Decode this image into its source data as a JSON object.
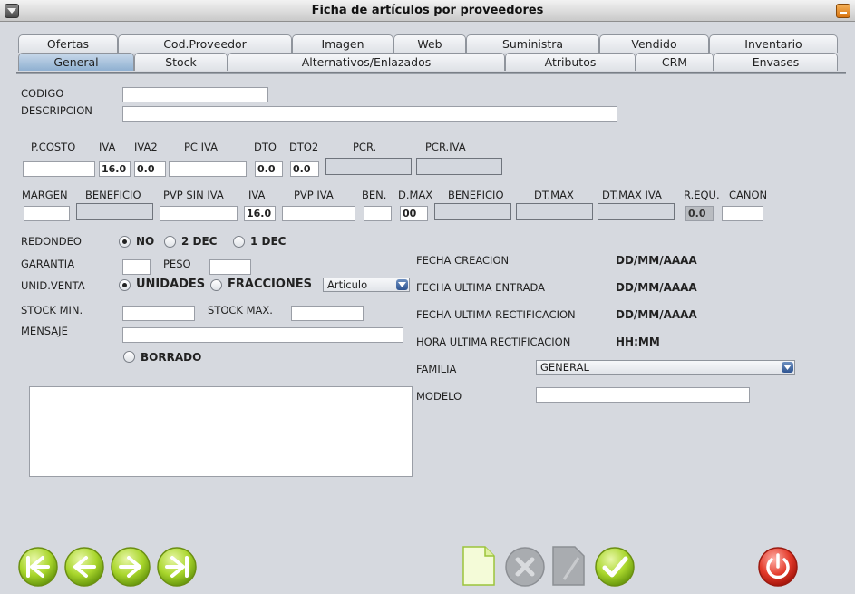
{
  "window": {
    "title": "Ficha de artículos por proveedores"
  },
  "tabs_top": [
    "Ofertas",
    "Cod.Proveedor",
    "Imagen",
    "Web",
    "Suministra",
    "Vendido",
    "Inventario"
  ],
  "tabs_bottom": [
    "General",
    "Stock",
    "Alternativos/Enlazados",
    "Atributos",
    "CRM",
    "Envases"
  ],
  "active_tab": "General",
  "form": {
    "codigo_label": "CODIGO",
    "descripcion_label": "DESCRIPCION",
    "row1_labels": [
      "P.COSTO",
      "IVA",
      "IVA2",
      "PC IVA",
      "DTO",
      "DTO2",
      "PCR.",
      "PCR.IVA"
    ],
    "row1_values": {
      "iva": "16.0",
      "iva2": "0.0",
      "dto": "0.0",
      "dto2": "0.0"
    },
    "row2_labels": [
      "MARGEN",
      "BENEFICIO",
      "PVP SIN IVA",
      "IVA",
      "PVP IVA",
      "BEN.",
      "D.MAX",
      "BENEFICIO",
      "DT.MAX",
      "DT.MAX IVA",
      "R.EQU.",
      "CANON"
    ],
    "row2_values": {
      "iva": "16.0",
      "dmax": "00",
      "requ": "0.0"
    },
    "redondeo_label": "REDONDEO",
    "redondeo_options": [
      "NO",
      "2 DEC",
      "1 DEC"
    ],
    "garantia_label": "GARANTIA",
    "peso_label": "PESO",
    "unid_venta_label": "UNID.VENTA",
    "unid_venta_options": [
      "UNIDADES",
      "FRACCIONES"
    ],
    "unid_venta_select": "Articulo",
    "stock_min_label": "STOCK MIN.",
    "stock_max_label": "STOCK MAX.",
    "mensaje_label": "MENSAJE",
    "borrado_label": "BORRADO",
    "fecha_creacion_label": "FECHA CREACION",
    "fecha_creacion_value": "DD/MM/AAAA",
    "fecha_entrada_label": "FECHA ULTIMA ENTRADA",
    "fecha_entrada_value": "DD/MM/AAAA",
    "fecha_rect_label": "FECHA ULTIMA RECTIFICACION",
    "fecha_rect_value": "DD/MM/AAAA",
    "hora_rect_label": "HORA ULTIMA RECTIFICACION",
    "hora_rect_value": "HH:MM",
    "familia_label": "FAMILIA",
    "familia_value": "GENERAL",
    "modelo_label": "MODELO"
  },
  "toolbar": {
    "nav": [
      "first-icon",
      "previous-icon",
      "next-icon",
      "last-icon"
    ],
    "actions": [
      "new-document-icon",
      "delete-icon",
      "edit-icon",
      "accept-icon",
      "power-icon"
    ]
  }
}
